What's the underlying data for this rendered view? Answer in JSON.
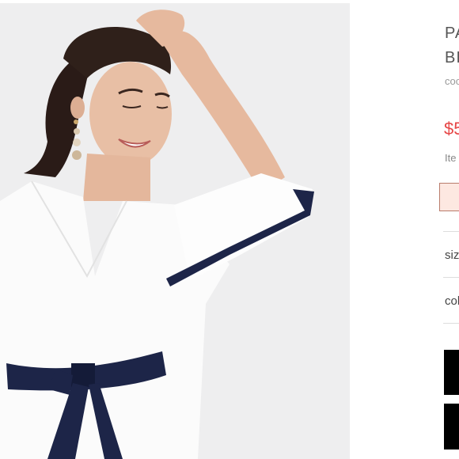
{
  "product": {
    "image_alt": "Model wearing white V-neck dress with navy contrast trim and tie belt",
    "title_line_1": "PA",
    "title_line_2": "BI",
    "sku": "coo",
    "price": "$5",
    "item_note": "Ite"
  },
  "options": {
    "size_label": "siz",
    "color_label": "col"
  },
  "actions": {
    "primary_label": "",
    "secondary_label": ""
  },
  "colors": {
    "price_red": "#e64545",
    "dress_navy": "#1d2548",
    "background_gray": "#eeeeef"
  }
}
